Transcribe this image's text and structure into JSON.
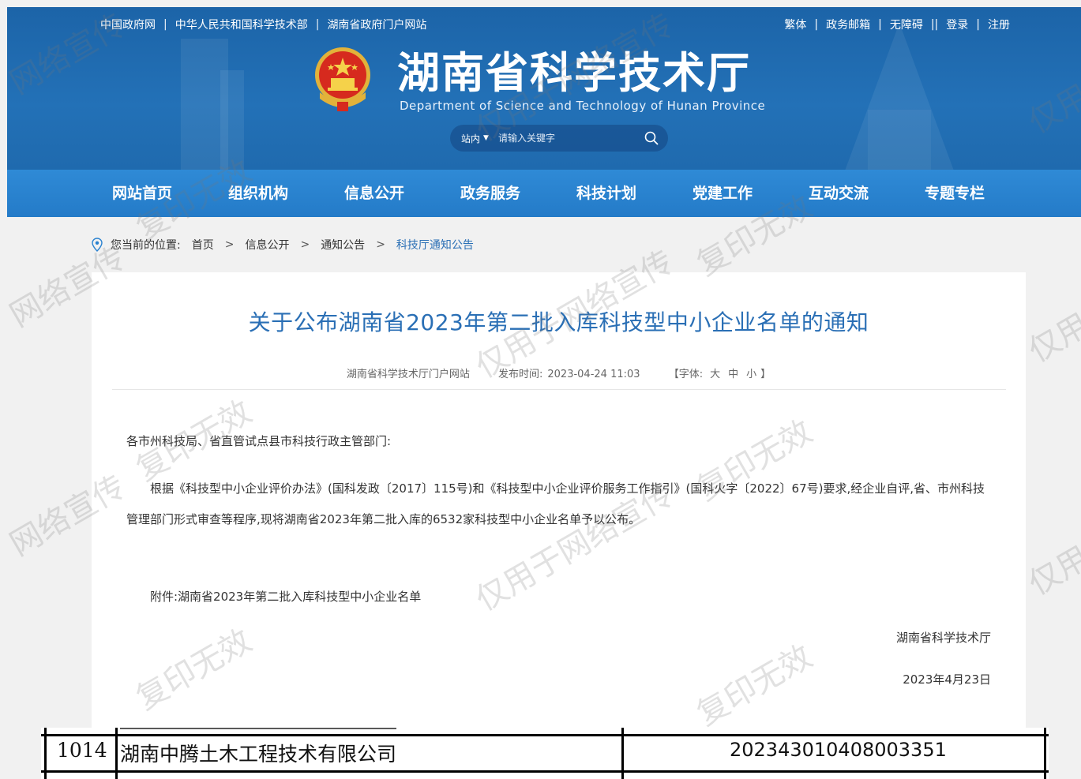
{
  "header": {
    "top_links": [
      "中国政府网",
      "中华人民共和国科学技术部",
      "湖南省政府门户网站"
    ],
    "top_right": [
      "繁体",
      "政务邮箱",
      "无障碍",
      "登录",
      "注册"
    ],
    "site_title": "湖南省科学技术厅",
    "site_subtitle": "Department of Science and Technology of Hunan Province",
    "search": {
      "scope": "站内",
      "placeholder": "请输入关键字"
    }
  },
  "nav": [
    "网站首页",
    "组织机构",
    "信息公开",
    "政务服务",
    "科技计划",
    "党建工作",
    "互动交流",
    "专题专栏"
  ],
  "breadcrumb": {
    "label": "您当前的位置:",
    "items": [
      "首页",
      "信息公开",
      "通知公告"
    ],
    "current": "科技厅通知公告"
  },
  "article": {
    "title": "关于公布湖南省2023年第二批入库科技型中小企业名单的通知",
    "source": "湖南省科学技术厅门户网站",
    "publish_label": "发布时间:",
    "publish_time": "2023-04-24 11:03",
    "font_label": "【字体:",
    "font_sizes": [
      "大",
      "中",
      "小"
    ],
    "font_end": "】",
    "salutation": "各市州科技局、省直管试点县市科技行政主管部门:",
    "paragraph": "根据《科技型中小企业评价办法》(国科发政〔2017〕115号)和《科技型中小企业评价服务工作指引》(国科火字〔2022〕67号)要求,经企业自评,省、市州科技管理部门形式审查等程序,现将湖南省2023年第二批入库的6532家科技型中小企业名单予以公布。",
    "attachment": "附件:湖南省2023年第二批入库科技型中小企业名单",
    "signature": "湖南省科学技术厅",
    "date": "2023年4月23日"
  },
  "table_row": {
    "index": "1014",
    "company": "湖南中腾土木工程技术有限公司",
    "code": "202343010408003351"
  },
  "watermarks": [
    "网络宣传",
    "复印无效",
    "仅用于网络宣传",
    "仅用于",
    "复印无效",
    "仅用于网络宣传"
  ],
  "colors": {
    "header_bg": "#1e68ad",
    "nav_bg": "#2a82d0",
    "title_blue": "#2a6fb5"
  }
}
